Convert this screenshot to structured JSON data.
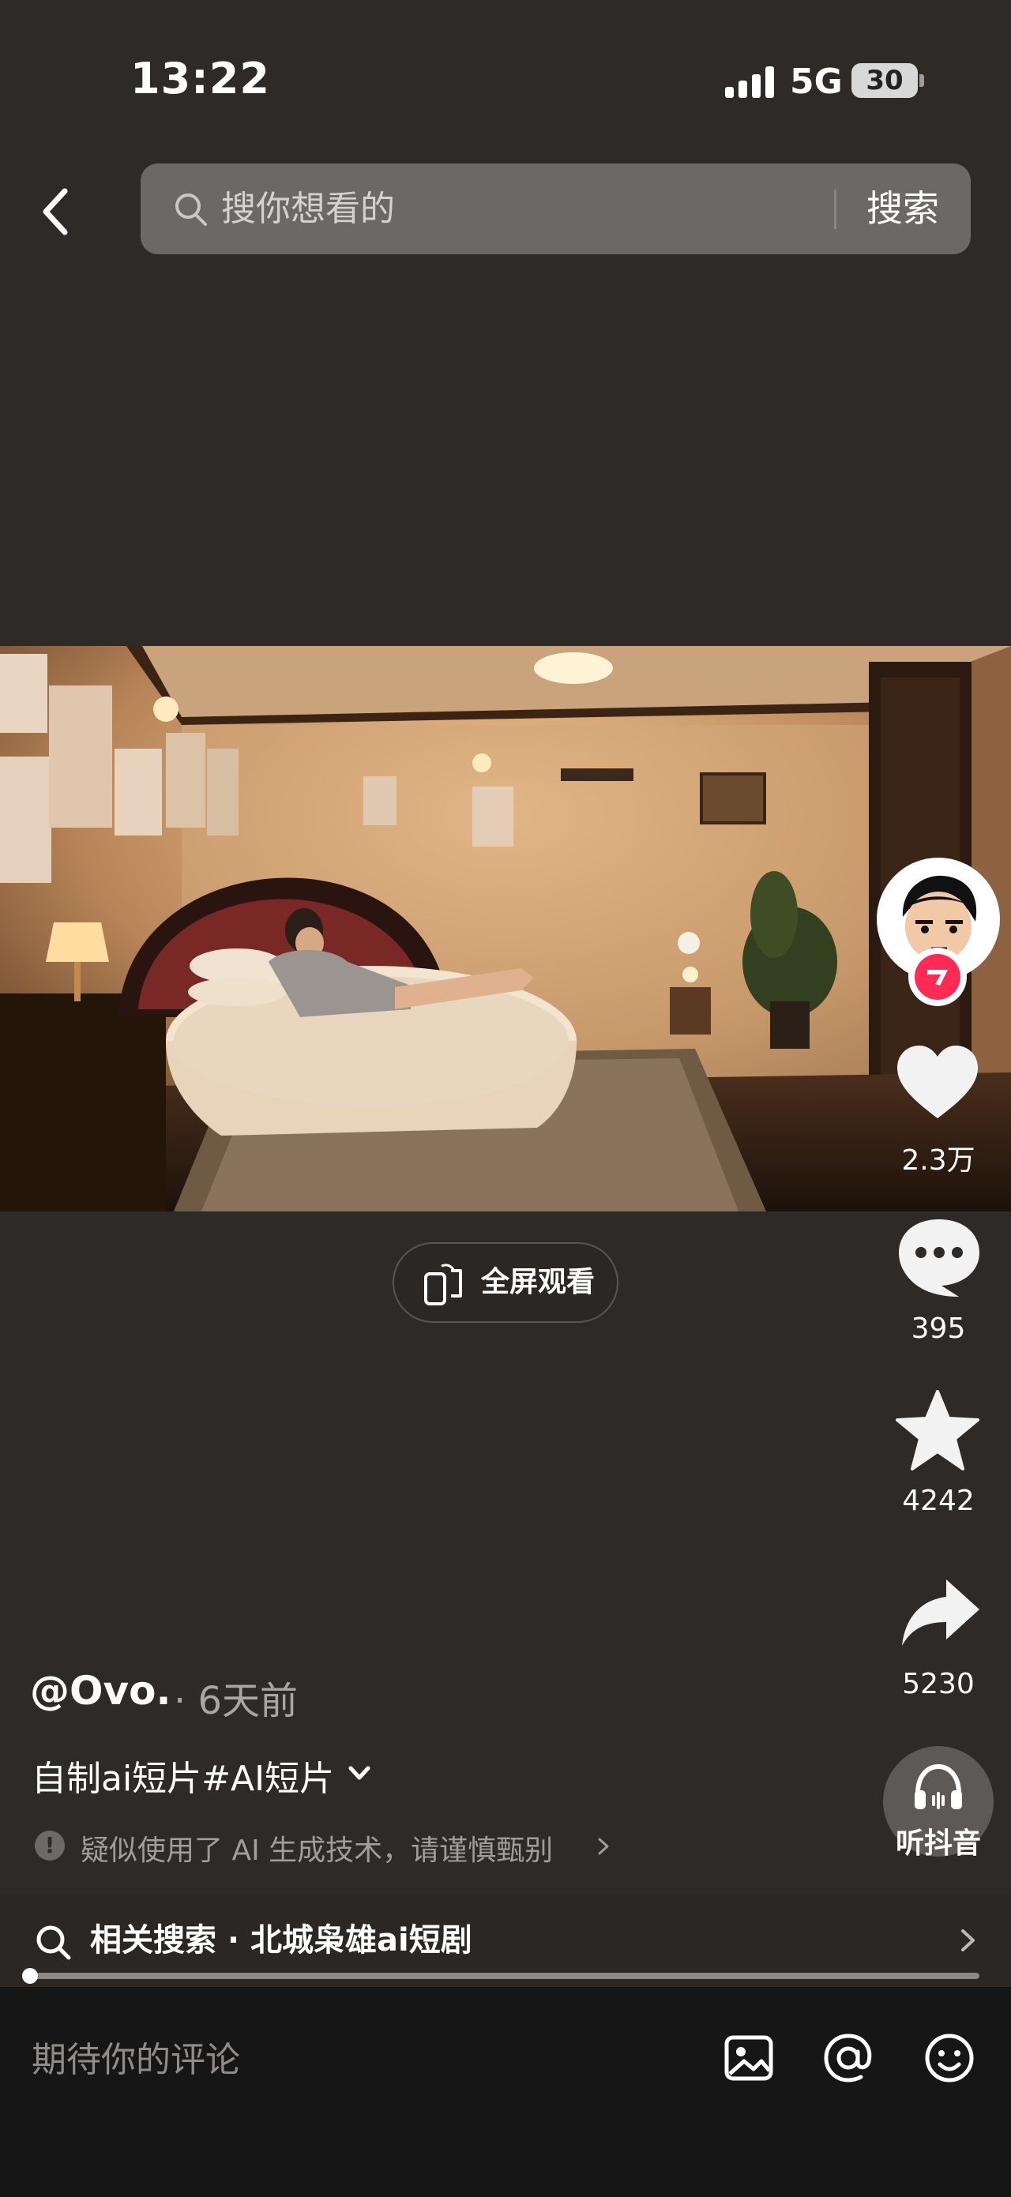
{
  "status_bar": {
    "time": "13:22",
    "network": "5G",
    "battery": "30"
  },
  "header": {
    "search_placeholder": "搜你想看的",
    "search_button": "搜索"
  },
  "video": {
    "fullscreen_label": "全屏观看"
  },
  "actions": {
    "likes": "2.3万",
    "comments": "395",
    "favorites": "4242",
    "shares": "5230",
    "listen_label": "听抖音"
  },
  "post": {
    "author": "@Ovo.",
    "time": "· 6天前",
    "caption": "自制ai短片#AI短片",
    "ai_notice": "疑似使用了 AI 生成技术，请谨慎甄别"
  },
  "related_search": {
    "label": "相关搜索 · 北城枭雄ai短剧"
  },
  "comment_bar": {
    "placeholder": "期待你的评论"
  },
  "colors": {
    "background": "#2e2a27",
    "brand_red": "#fe2c55",
    "search_bg": "#6b6866"
  }
}
